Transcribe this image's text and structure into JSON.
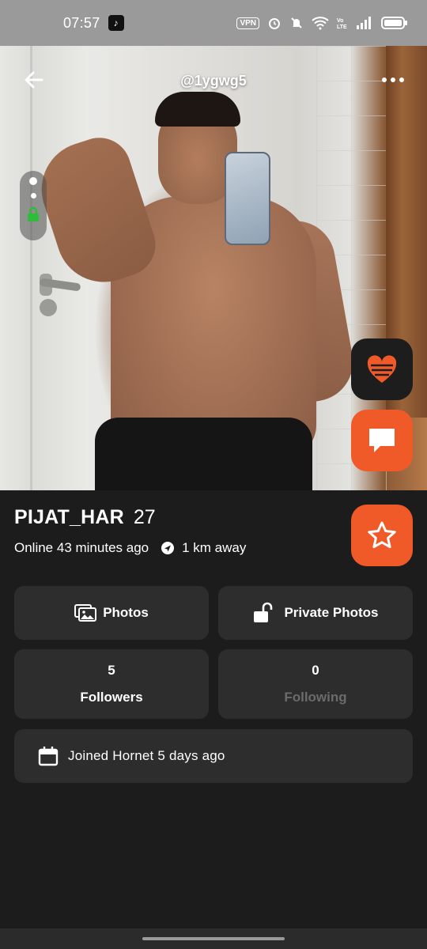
{
  "status_bar": {
    "time": "07:57",
    "vpn": "VPN"
  },
  "profile": {
    "handle": "@1ygwg5",
    "name": "PIJAT_HAR",
    "age": "27",
    "online": "Online 43 minutes ago",
    "distance": "1 km away"
  },
  "actions": {
    "photos_label": "Photos",
    "private_photos_label": "Private Photos"
  },
  "stats": {
    "followers_count": "5",
    "followers_label": "Followers",
    "following_count": "0",
    "following_label": "Following"
  },
  "joined": "Joined Hornet 5 days ago",
  "colors": {
    "accent": "#f05a28",
    "background": "#1c1c1c",
    "card": "#2d2d2d"
  },
  "icons": [
    "back-arrow-icon",
    "more-icon",
    "heart-icon",
    "chat-icon",
    "star-icon",
    "navigation-icon",
    "photos-icon",
    "unlock-icon",
    "calendar-icon",
    "lock-icon"
  ]
}
